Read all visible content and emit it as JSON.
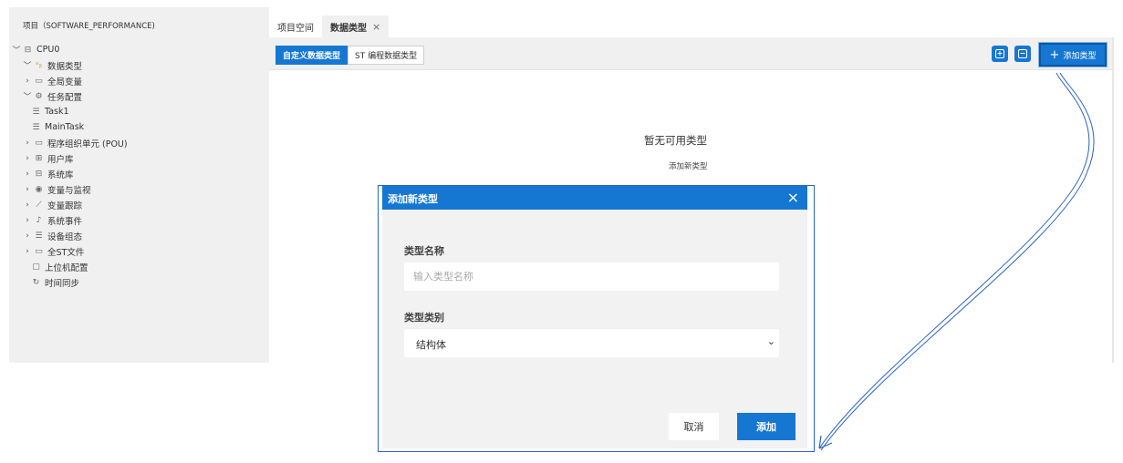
{
  "project": {
    "title": "项目（SOFTWARE_PERFORMANCE)"
  },
  "tree": [
    {
      "chevron": "﹀",
      "icon": "⊟",
      "icon_name": "device-icon",
      "label": "CPU0",
      "indent": 0
    },
    {
      "chevron": "﹀",
      "icon": "ᵃᵦ",
      "icon_name": "data-type-icon",
      "label": "数据类型",
      "indent": 1
    },
    {
      "chevron": "›",
      "icon": "▭",
      "icon_name": "folder-icon",
      "label": "全局变量",
      "indent": 1
    },
    {
      "chevron": "﹀",
      "icon": "⚙",
      "icon_name": "gear-icon",
      "label": "任务配置",
      "indent": 1
    },
    {
      "chevron": "",
      "icon": "☰",
      "icon_name": "task-list-icon",
      "label": "Task1",
      "indent": 1
    },
    {
      "chevron": "",
      "icon": "☰",
      "icon_name": "task-list-icon",
      "label": "MainTask",
      "indent": 1
    },
    {
      "chevron": "›",
      "icon": "▭",
      "icon_name": "folder-icon",
      "label": "程序组织单元 (POU)",
      "indent": 1
    },
    {
      "chevron": "›",
      "icon": "⊞",
      "icon_name": "library-icon",
      "label": "用户库",
      "indent": 1
    },
    {
      "chevron": "›",
      "icon": "⊟",
      "icon_name": "system-library-icon",
      "label": "系统库",
      "indent": 1
    },
    {
      "chevron": "›",
      "icon": "◉",
      "icon_name": "eye-icon",
      "label": "变量与监视",
      "indent": 1
    },
    {
      "chevron": "›",
      "icon": "⟋",
      "icon_name": "trend-icon",
      "label": "变量跟踪",
      "indent": 1
    },
    {
      "chevron": "›",
      "icon": "♪",
      "icon_name": "bell-icon",
      "label": "系统事件",
      "indent": 1
    },
    {
      "chevron": "›",
      "icon": "☰",
      "icon_name": "device-config-icon",
      "label": "设备组态",
      "indent": 1
    },
    {
      "chevron": "›",
      "icon": "▭",
      "icon_name": "folder-icon",
      "label": "全ST文件",
      "indent": 1
    },
    {
      "chevron": "",
      "icon": "▢",
      "icon_name": "monitor-icon",
      "label": "上位机配置",
      "indent": 1
    },
    {
      "chevron": "",
      "icon": "↻",
      "icon_name": "sync-icon",
      "label": "时间同步",
      "indent": 1
    }
  ],
  "tabs": {
    "workspace": "项目空间",
    "datatypes": "数据类型",
    "close": "×"
  },
  "toolbar": {
    "custom_types": "自定义数据类型",
    "st_types": "ST 编程数据类型",
    "add_type_plus": "+",
    "add_type": "添加类型"
  },
  "empty": {
    "title": "暂无可用类型",
    "subtitle": "添加新类型"
  },
  "modal": {
    "title": "添加新类型",
    "close": "×",
    "name_label": "类型名称",
    "name_placeholder": "输入类型名称",
    "kind_label": "类型类别",
    "kind_value": "结构体",
    "kind_chevron": "⌄",
    "cancel": "取消",
    "ok": "添加"
  },
  "colors": {
    "accent": "#1677d2",
    "annotation": "#2a63c9"
  }
}
